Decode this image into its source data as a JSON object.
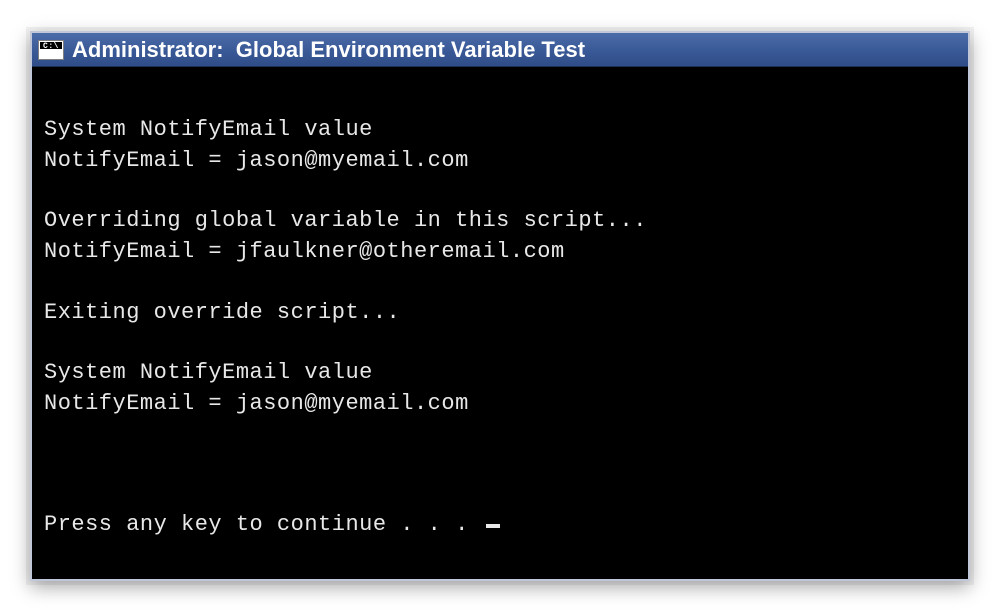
{
  "window": {
    "icon_label": "C:\\",
    "title": "Administrator:  Global Environment Variable Test"
  },
  "console": {
    "lines": [
      "",
      "System NotifyEmail value",
      "NotifyEmail = jason@myemail.com",
      "",
      "Overriding global variable in this script...",
      "NotifyEmail = jfaulkner@otheremail.com",
      "",
      "Exiting override script...",
      "",
      "System NotifyEmail value",
      "NotifyEmail = jason@myemail.com",
      "",
      "",
      ""
    ],
    "prompt": "Press any key to continue . . . "
  },
  "colors": {
    "titlebar_gradient_top": "#4a6ca8",
    "titlebar_gradient_bottom": "#2f4d88",
    "console_bg": "#000000",
    "console_fg": "#e8e8e8"
  }
}
